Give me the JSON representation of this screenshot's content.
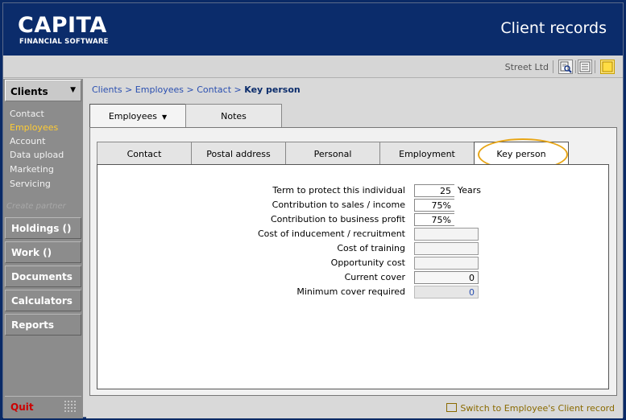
{
  "app": {
    "brand": "CAPITA",
    "brand_sub": "FINANCIAL SOFTWARE",
    "title": "Client records",
    "company": "Street Ltd"
  },
  "toolbar": {
    "icons": [
      "search-icon",
      "list-icon",
      "note-icon"
    ]
  },
  "sidebar": {
    "section": "Clients",
    "sub_items": [
      {
        "label": "Contact",
        "active": false
      },
      {
        "label": "Employees",
        "active": true
      },
      {
        "label": "Account",
        "active": false
      },
      {
        "label": "Data upload",
        "active": false
      },
      {
        "label": "Marketing",
        "active": false
      },
      {
        "label": "Servicing",
        "active": false
      }
    ],
    "hidden_item": "Create partner",
    "buttons": [
      "Holdings ()",
      "Work ()",
      "Documents",
      "Calculators",
      "Reports"
    ],
    "quit": "Quit"
  },
  "breadcrumb": {
    "items": [
      "Clients",
      "Employees",
      "Contact"
    ],
    "current": "Key person",
    "sep": ">"
  },
  "top_tabs": [
    {
      "label": "Employees",
      "active": true,
      "has_menu": true
    },
    {
      "label": "Notes",
      "active": false
    }
  ],
  "sub_tabs": [
    {
      "label": "Contact",
      "active": false
    },
    {
      "label": "Postal address",
      "active": false
    },
    {
      "label": "Personal",
      "active": false
    },
    {
      "label": "Employment",
      "active": false
    },
    {
      "label": "Key person",
      "active": true
    }
  ],
  "form": {
    "rows": [
      {
        "label": "Term to protect this individual",
        "value": "25",
        "unit": "Years"
      },
      {
        "label": "Contribution to sales / income",
        "value": "75%"
      },
      {
        "label": "Contribution to business profit",
        "value": "75%"
      },
      {
        "label": "Cost of inducement / recruitment",
        "value": ""
      },
      {
        "label": "Cost of training",
        "value": ""
      },
      {
        "label": "Opportunity cost",
        "value": ""
      },
      {
        "label": "Current cover",
        "value": "0"
      },
      {
        "label": "Minimum cover required",
        "value": "0"
      }
    ]
  },
  "footer": {
    "link": "Switch to Employee's Client record"
  },
  "colors": {
    "header_bg": "#0b2c6b",
    "highlight": "#e8a617",
    "link": "#2a4fb0",
    "active_nav": "#ffcc33"
  }
}
